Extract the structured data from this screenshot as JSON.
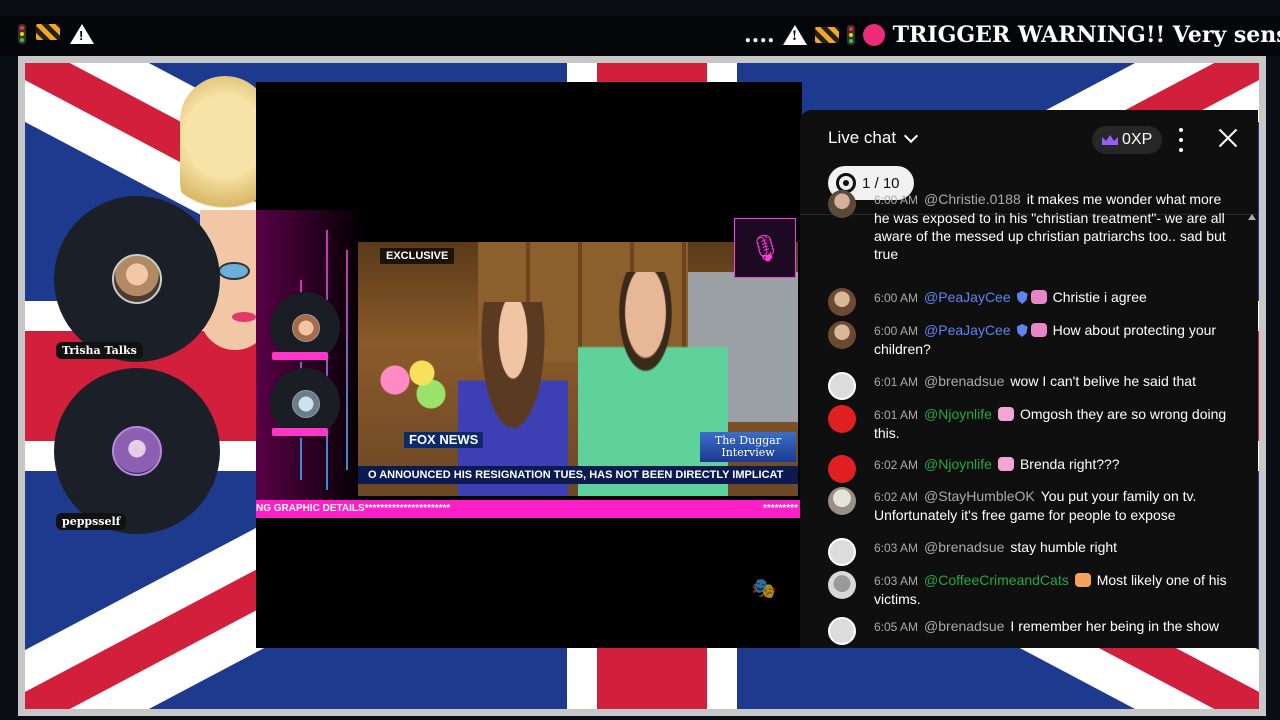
{
  "ticker": {
    "left_icons": [
      "traffic-light-icon",
      "barrier-icon",
      "warning-icon"
    ],
    "right_text": "TRIGGER WARNING!! Very sensit",
    "right_prefix": "...."
  },
  "stream": {
    "cam1_label": "Trisha Talks",
    "cam2_label": "peppsself"
  },
  "news": {
    "exclusive": "EXCLUSIVE",
    "fox": "FOX NEWS",
    "duggar": "The Duggar Interview",
    "chyron": "O ANNOUNCED HIS RESIGNATION TUES, HAS NOT BEEN DIRECTLY IMPLICAT",
    "pinkbar_left": "NG GRAPHIC DETAILS**********************",
    "pinkbar_right": "*********"
  },
  "chat": {
    "title": "Live chat",
    "xp": "0XP",
    "poll": "1 / 10",
    "messages": [
      {
        "time": "6:00 AM",
        "author": "@Christie.0188",
        "text": "it makes me wonder what more he was exposed to in his \"christian treatment\"- we are all aware of the messed up christian patriarchs too.. sad but true",
        "color": "gray",
        "avatar": "christie"
      },
      {
        "time": "6:00 AM",
        "author": "@PeaJayCee",
        "text": "Christie i agree",
        "color": "blue",
        "avatar": "peajay"
      },
      {
        "time": "6:00 AM",
        "author": "@PeaJayCee",
        "text": "How about protecting your children?",
        "color": "blue",
        "avatar": "peajay"
      },
      {
        "time": "6:01 AM",
        "author": "@brenadsue",
        "text": "wow I can't belive he said that",
        "color": "gray",
        "avatar": "brenad"
      },
      {
        "time": "6:01 AM",
        "author": "@Njoynlife",
        "text": "Omgosh they are so wrong doing this.",
        "color": "green",
        "avatar": "njoy"
      },
      {
        "time": "6:02 AM",
        "author": "@Njoynlife",
        "text": "Brenda right???",
        "color": "green",
        "avatar": "njoy"
      },
      {
        "time": "6:02 AM",
        "author": "@StayHumbleOK",
        "text": "You put your family on tv. Unfortunately it's free game for people to expose",
        "color": "gray",
        "avatar": "stay"
      },
      {
        "time": "6:03 AM",
        "author": "@brenadsue",
        "text": "stay humble right",
        "color": "gray",
        "avatar": "brenad"
      },
      {
        "time": "6:03 AM",
        "author": "@CoffeeCrimeandCats",
        "text": "Most likely one of his victims.",
        "color": "green",
        "avatar": "coffee"
      },
      {
        "time": "6:05 AM",
        "author": "@brenadsue",
        "text": "I remember her being in the show",
        "color": "gray",
        "avatar": "brenad"
      }
    ]
  },
  "colors": {
    "accent_pink": "#ff1fc8",
    "chat_bg": "#0f0f0f",
    "author_green": "#2ba640",
    "author_blue": "#5e84f1"
  }
}
